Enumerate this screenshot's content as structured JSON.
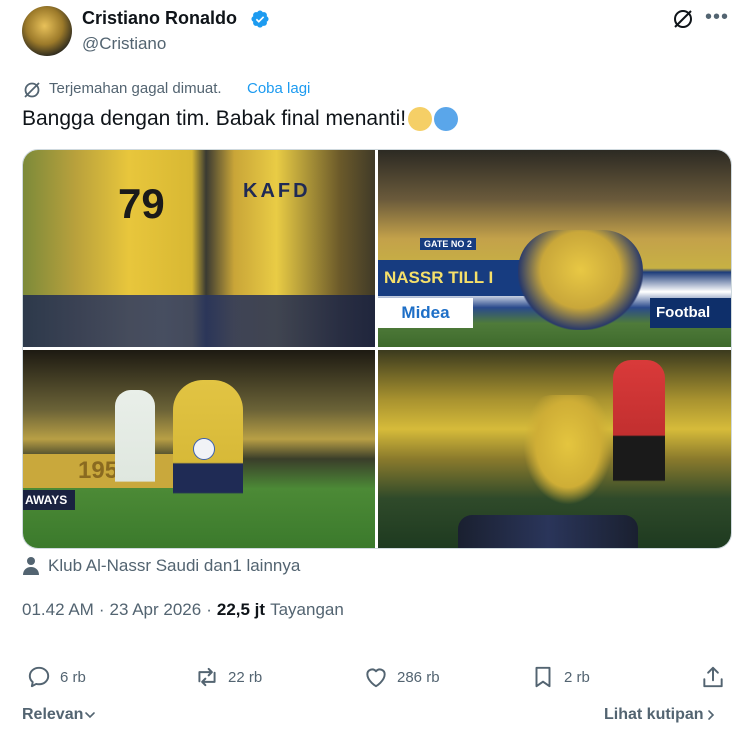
{
  "author": {
    "name": "Cristiano Ronaldo",
    "handle": "@Cristiano"
  },
  "translation": {
    "status": "Terjemahan gagal dimuat.",
    "retry": "Coba lagi"
  },
  "tweet": {
    "text": "Bangga dengan tim. Babak final menanti!",
    "emojis": [
      "yellow-heart",
      "blue-heart"
    ]
  },
  "photos": [
    {
      "alt": "Players in yellow jerseys, number 79 and KAFD sponsor",
      "shirt_number": "79",
      "sponsor": "KAFD"
    },
    {
      "alt": "Team huddle on pitch in front of stands",
      "board_text": "NASSR TILL I",
      "ad_1": "Midea",
      "ad_2": "Footbal",
      "banner": "GATE NO 2"
    },
    {
      "alt": "Ronaldo dribbling the ball",
      "board_text": "1955",
      "ad": "AWAYS"
    },
    {
      "alt": "Players celebrating on the ground, referee nearby"
    }
  ],
  "tagged": "Klub Al-Nassr Saudi dan1 lainnya",
  "meta": {
    "time": "01.42 AM",
    "separator": "·",
    "date": "23 Apr 2026",
    "views_count": "22,5 jt",
    "views_label": "Tayangan"
  },
  "actions": {
    "replies": "6 rb",
    "reposts": "22 rb",
    "likes": "286 rb",
    "bookmarks": "2 rb"
  },
  "footer": {
    "sort": "Relevan",
    "quotes": "Lihat kutipan"
  },
  "colors": {
    "accent": "#1d9bf0",
    "secondary_text": "#536471",
    "primary_text": "#0f1419"
  }
}
